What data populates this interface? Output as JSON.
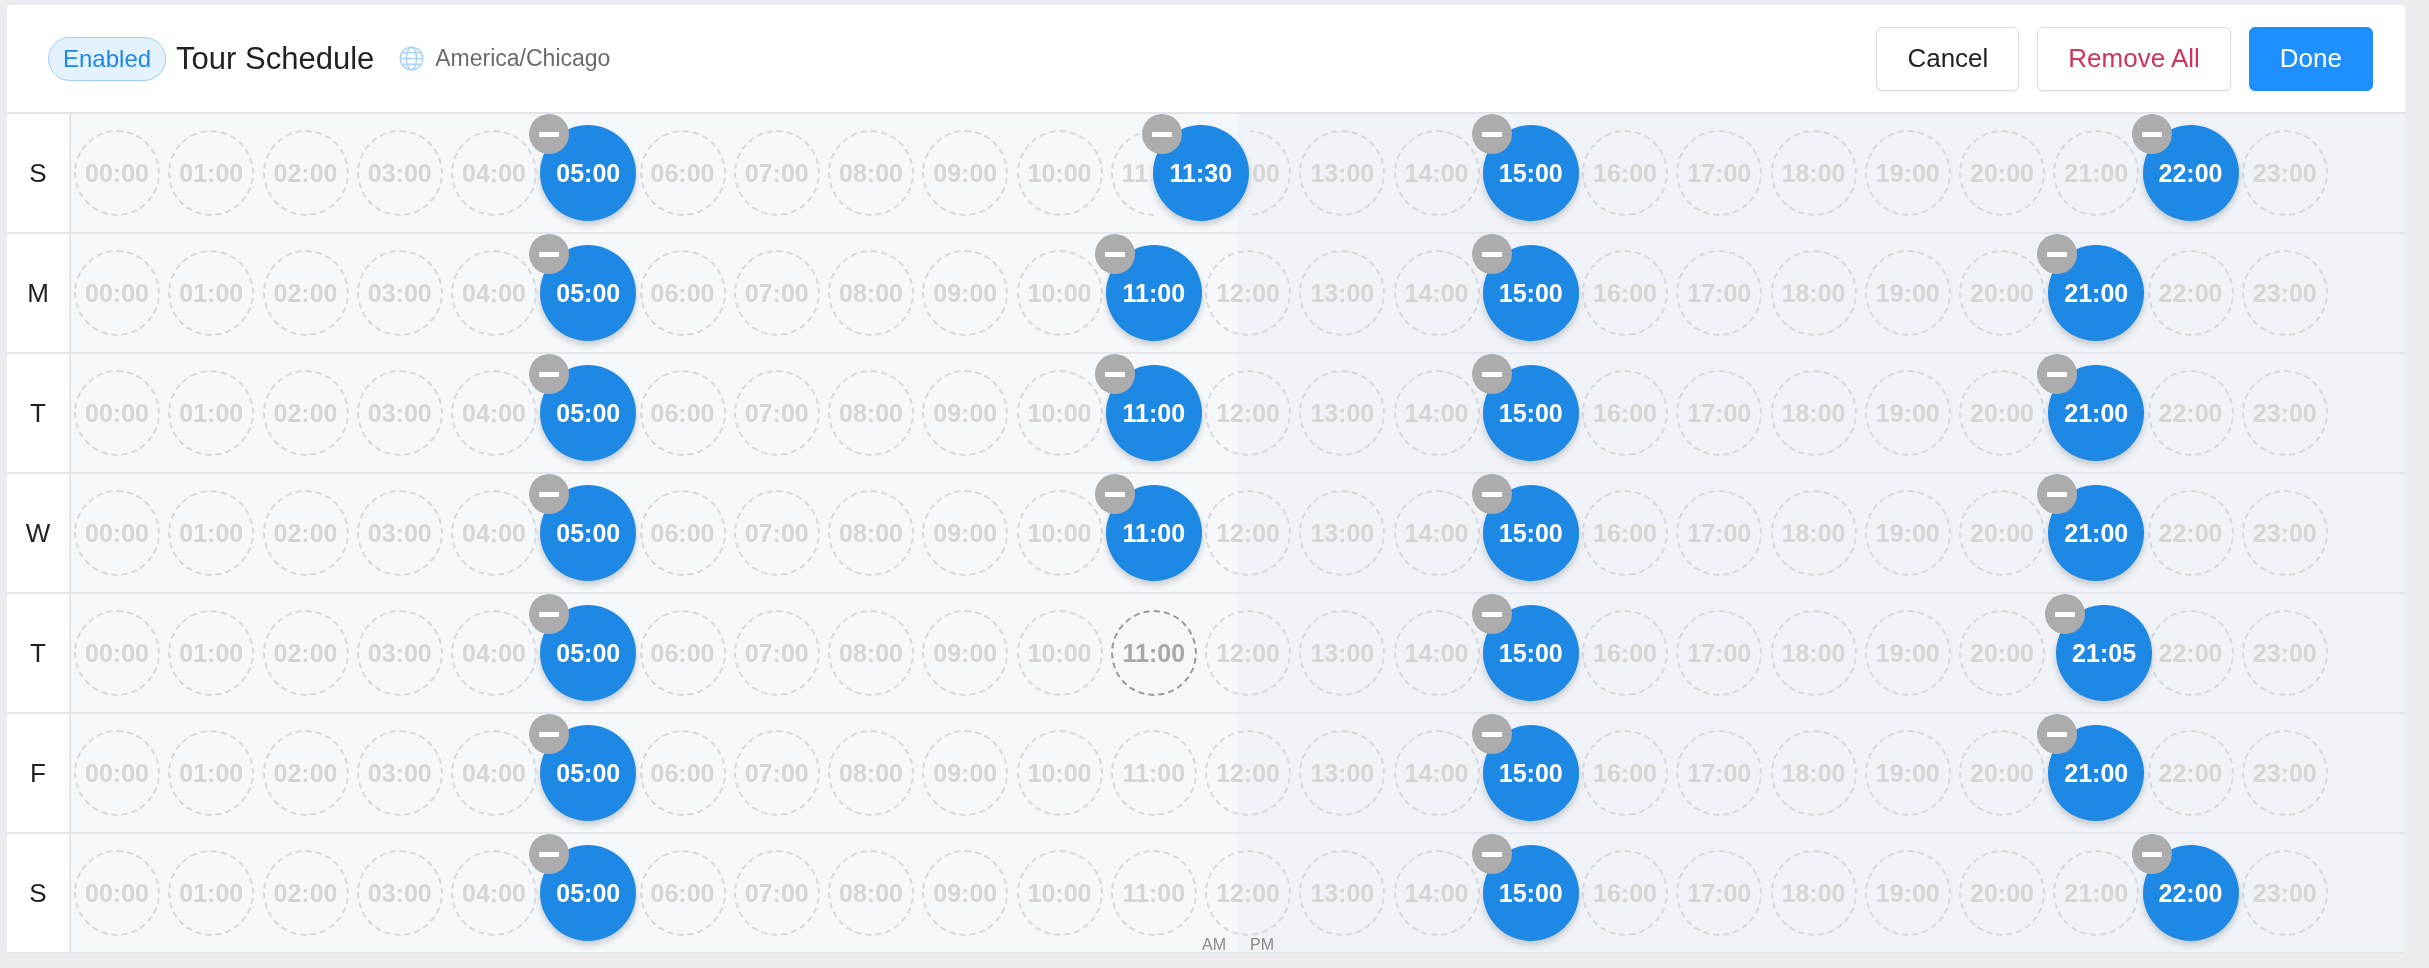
{
  "header": {
    "status": "Enabled",
    "title": "Tour Schedule",
    "timezone": "America/Chicago",
    "buttons": [
      {
        "label": "Cancel",
        "kind": "plain"
      },
      {
        "label": "Remove All",
        "kind": "danger"
      },
      {
        "label": "Done",
        "kind": "primary"
      }
    ]
  },
  "days": [
    {
      "day": "S",
      "slots": [
        {
          "kind": "open",
          "label": "00:00",
          "hovered": false
        },
        {
          "kind": "open",
          "label": "01:00",
          "hovered": false
        },
        {
          "kind": "open",
          "label": "02:00",
          "hovered": false
        },
        {
          "kind": "open",
          "label": "03:00",
          "hovered": false
        },
        {
          "kind": "open",
          "label": "04:00",
          "hovered": false
        },
        {
          "kind": "covered"
        },
        {
          "kind": "open",
          "label": "06:00",
          "hovered": false
        },
        {
          "kind": "open",
          "label": "07:00",
          "hovered": false
        },
        {
          "kind": "open",
          "label": "08:00",
          "hovered": false
        },
        {
          "kind": "open",
          "label": "09:00",
          "hovered": false
        },
        {
          "kind": "open",
          "label": "10:00",
          "hovered": false
        },
        {
          "kind": "head",
          "label": "11",
          "hovered": false
        },
        {
          "kind": "tail",
          "label": "00",
          "hovered": false
        },
        {
          "kind": "open",
          "label": "13:00",
          "hovered": false
        },
        {
          "kind": "open",
          "label": "14:00",
          "hovered": false
        },
        {
          "kind": "covered"
        },
        {
          "kind": "open",
          "label": "16:00",
          "hovered": false
        },
        {
          "kind": "open",
          "label": "17:00",
          "hovered": false
        },
        {
          "kind": "open",
          "label": "18:00",
          "hovered": false
        },
        {
          "kind": "open",
          "label": "19:00",
          "hovered": false
        },
        {
          "kind": "open",
          "label": "20:00",
          "hovered": false
        },
        {
          "kind": "open",
          "label": "21:00",
          "hovered": false
        },
        {
          "kind": "covered"
        },
        {
          "kind": "open",
          "label": "23:00",
          "hovered": false
        }
      ],
      "times": [
        {
          "label": "05:00"
        },
        {
          "label": "11:30"
        },
        {
          "label": "15:00"
        },
        {
          "label": "22:00"
        }
      ]
    },
    {
      "day": "M",
      "slots": [
        {
          "kind": "open",
          "label": "00:00",
          "hovered": false
        },
        {
          "kind": "open",
          "label": "01:00",
          "hovered": false
        },
        {
          "kind": "open",
          "label": "02:00",
          "hovered": false
        },
        {
          "kind": "open",
          "label": "03:00",
          "hovered": false
        },
        {
          "kind": "open",
          "label": "04:00",
          "hovered": false
        },
        {
          "kind": "covered"
        },
        {
          "kind": "open",
          "label": "06:00",
          "hovered": false
        },
        {
          "kind": "open",
          "label": "07:00",
          "hovered": false
        },
        {
          "kind": "open",
          "label": "08:00",
          "hovered": false
        },
        {
          "kind": "open",
          "label": "09:00",
          "hovered": false
        },
        {
          "kind": "open",
          "label": "10:00",
          "hovered": false
        },
        {
          "kind": "covered"
        },
        {
          "kind": "open",
          "label": "12:00",
          "hovered": false
        },
        {
          "kind": "open",
          "label": "13:00",
          "hovered": false
        },
        {
          "kind": "open",
          "label": "14:00",
          "hovered": false
        },
        {
          "kind": "covered"
        },
        {
          "kind": "open",
          "label": "16:00",
          "hovered": false
        },
        {
          "kind": "open",
          "label": "17:00",
          "hovered": false
        },
        {
          "kind": "open",
          "label": "18:00",
          "hovered": false
        },
        {
          "kind": "open",
          "label": "19:00",
          "hovered": false
        },
        {
          "kind": "open",
          "label": "20:00",
          "hovered": false
        },
        {
          "kind": "covered"
        },
        {
          "kind": "open",
          "label": "22:00",
          "hovered": false
        },
        {
          "kind": "open",
          "label": "23:00",
          "hovered": false
        }
      ],
      "times": [
        {
          "label": "05:00"
        },
        {
          "label": "11:00"
        },
        {
          "label": "15:00"
        },
        {
          "label": "21:00"
        }
      ]
    },
    {
      "day": "T",
      "slots": [
        {
          "kind": "open",
          "label": "00:00",
          "hovered": false
        },
        {
          "kind": "open",
          "label": "01:00",
          "hovered": false
        },
        {
          "kind": "open",
          "label": "02:00",
          "hovered": false
        },
        {
          "kind": "open",
          "label": "03:00",
          "hovered": false
        },
        {
          "kind": "open",
          "label": "04:00",
          "hovered": false
        },
        {
          "kind": "covered"
        },
        {
          "kind": "open",
          "label": "06:00",
          "hovered": false
        },
        {
          "kind": "open",
          "label": "07:00",
          "hovered": false
        },
        {
          "kind": "open",
          "label": "08:00",
          "hovered": false
        },
        {
          "kind": "open",
          "label": "09:00",
          "hovered": false
        },
        {
          "kind": "open",
          "label": "10:00",
          "hovered": false
        },
        {
          "kind": "covered"
        },
        {
          "kind": "open",
          "label": "12:00",
          "hovered": false
        },
        {
          "kind": "open",
          "label": "13:00",
          "hovered": false
        },
        {
          "kind": "open",
          "label": "14:00",
          "hovered": false
        },
        {
          "kind": "covered"
        },
        {
          "kind": "open",
          "label": "16:00",
          "hovered": false
        },
        {
          "kind": "open",
          "label": "17:00",
          "hovered": false
        },
        {
          "kind": "open",
          "label": "18:00",
          "hovered": false
        },
        {
          "kind": "open",
          "label": "19:00",
          "hovered": false
        },
        {
          "kind": "open",
          "label": "20:00",
          "hovered": false
        },
        {
          "kind": "covered"
        },
        {
          "kind": "open",
          "label": "22:00",
          "hovered": false
        },
        {
          "kind": "open",
          "label": "23:00",
          "hovered": false
        }
      ],
      "times": [
        {
          "label": "05:00"
        },
        {
          "label": "11:00"
        },
        {
          "label": "15:00"
        },
        {
          "label": "21:00"
        }
      ]
    },
    {
      "day": "W",
      "slots": [
        {
          "kind": "open",
          "label": "00:00",
          "hovered": false
        },
        {
          "kind": "open",
          "label": "01:00",
          "hovered": false
        },
        {
          "kind": "open",
          "label": "02:00",
          "hovered": false
        },
        {
          "kind": "open",
          "label": "03:00",
          "hovered": false
        },
        {
          "kind": "open",
          "label": "04:00",
          "hovered": false
        },
        {
          "kind": "covered"
        },
        {
          "kind": "open",
          "label": "06:00",
          "hovered": false
        },
        {
          "kind": "open",
          "label": "07:00",
          "hovered": false
        },
        {
          "kind": "open",
          "label": "08:00",
          "hovered": false
        },
        {
          "kind": "open",
          "label": "09:00",
          "hovered": false
        },
        {
          "kind": "open",
          "label": "10:00",
          "hovered": false
        },
        {
          "kind": "covered"
        },
        {
          "kind": "open",
          "label": "12:00",
          "hovered": false
        },
        {
          "kind": "open",
          "label": "13:00",
          "hovered": false
        },
        {
          "kind": "open",
          "label": "14:00",
          "hovered": false
        },
        {
          "kind": "covered"
        },
        {
          "kind": "open",
          "label": "16:00",
          "hovered": false
        },
        {
          "kind": "open",
          "label": "17:00",
          "hovered": false
        },
        {
          "kind": "open",
          "label": "18:00",
          "hovered": false
        },
        {
          "kind": "open",
          "label": "19:00",
          "hovered": false
        },
        {
          "kind": "open",
          "label": "20:00",
          "hovered": false
        },
        {
          "kind": "covered"
        },
        {
          "kind": "open",
          "label": "22:00",
          "hovered": false
        },
        {
          "kind": "open",
          "label": "23:00",
          "hovered": false
        }
      ],
      "times": [
        {
          "label": "05:00"
        },
        {
          "label": "11:00"
        },
        {
          "label": "15:00"
        },
        {
          "label": "21:00"
        }
      ]
    },
    {
      "day": "T",
      "slots": [
        {
          "kind": "open",
          "label": "00:00",
          "hovered": false
        },
        {
          "kind": "open",
          "label": "01:00",
          "hovered": false
        },
        {
          "kind": "open",
          "label": "02:00",
          "hovered": false
        },
        {
          "kind": "open",
          "label": "03:00",
          "hovered": false
        },
        {
          "kind": "open",
          "label": "04:00",
          "hovered": false
        },
        {
          "kind": "covered"
        },
        {
          "kind": "open",
          "label": "06:00",
          "hovered": false
        },
        {
          "kind": "open",
          "label": "07:00",
          "hovered": false
        },
        {
          "kind": "open",
          "label": "08:00",
          "hovered": false
        },
        {
          "kind": "open",
          "label": "09:00",
          "hovered": false
        },
        {
          "kind": "open",
          "label": "10:00",
          "hovered": false
        },
        {
          "kind": "open",
          "label": "11:00",
          "hovered": true
        },
        {
          "kind": "open",
          "label": "12:00",
          "hovered": false
        },
        {
          "kind": "open",
          "label": "13:00",
          "hovered": false
        },
        {
          "kind": "open",
          "label": "14:00",
          "hovered": false
        },
        {
          "kind": "covered"
        },
        {
          "kind": "open",
          "label": "16:00",
          "hovered": false
        },
        {
          "kind": "open",
          "label": "17:00",
          "hovered": false
        },
        {
          "kind": "open",
          "label": "18:00",
          "hovered": false
        },
        {
          "kind": "open",
          "label": "19:00",
          "hovered": false
        },
        {
          "kind": "open",
          "label": "20:00",
          "hovered": false
        },
        {
          "kind": "covered"
        },
        {
          "kind": "open",
          "label": "22:00",
          "hovered": false
        },
        {
          "kind": "open",
          "label": "23:00",
          "hovered": false
        }
      ],
      "times": [
        {
          "label": "05:00"
        },
        {
          "label": "15:00"
        },
        {
          "label": "21:05"
        }
      ]
    },
    {
      "day": "F",
      "slots": [
        {
          "kind": "open",
          "label": "00:00",
          "hovered": false
        },
        {
          "kind": "open",
          "label": "01:00",
          "hovered": false
        },
        {
          "kind": "open",
          "label": "02:00",
          "hovered": false
        },
        {
          "kind": "open",
          "label": "03:00",
          "hovered": false
        },
        {
          "kind": "open",
          "label": "04:00",
          "hovered": false
        },
        {
          "kind": "covered"
        },
        {
          "kind": "open",
          "label": "06:00",
          "hovered": false
        },
        {
          "kind": "open",
          "label": "07:00",
          "hovered": false
        },
        {
          "kind": "open",
          "label": "08:00",
          "hovered": false
        },
        {
          "kind": "open",
          "label": "09:00",
          "hovered": false
        },
        {
          "kind": "open",
          "label": "10:00",
          "hovered": false
        },
        {
          "kind": "open",
          "label": "11:00",
          "hovered": false
        },
        {
          "kind": "open",
          "label": "12:00",
          "hovered": false
        },
        {
          "kind": "open",
          "label": "13:00",
          "hovered": false
        },
        {
          "kind": "open",
          "label": "14:00",
          "hovered": false
        },
        {
          "kind": "covered"
        },
        {
          "kind": "open",
          "label": "16:00",
          "hovered": false
        },
        {
          "kind": "open",
          "label": "17:00",
          "hovered": false
        },
        {
          "kind": "open",
          "label": "18:00",
          "hovered": false
        },
        {
          "kind": "open",
          "label": "19:00",
          "hovered": false
        },
        {
          "kind": "open",
          "label": "20:00",
          "hovered": false
        },
        {
          "kind": "covered"
        },
        {
          "kind": "open",
          "label": "22:00",
          "hovered": false
        },
        {
          "kind": "open",
          "label": "23:00",
          "hovered": false
        }
      ],
      "times": [
        {
          "label": "05:00"
        },
        {
          "label": "15:00"
        },
        {
          "label": "21:00"
        }
      ]
    },
    {
      "day": "S",
      "slots": [
        {
          "kind": "open",
          "label": "00:00",
          "hovered": false
        },
        {
          "kind": "open",
          "label": "01:00",
          "hovered": false
        },
        {
          "kind": "open",
          "label": "02:00",
          "hovered": false
        },
        {
          "kind": "open",
          "label": "03:00",
          "hovered": false
        },
        {
          "kind": "open",
          "label": "04:00",
          "hovered": false
        },
        {
          "kind": "covered"
        },
        {
          "kind": "open",
          "label": "06:00",
          "hovered": false
        },
        {
          "kind": "open",
          "label": "07:00",
          "hovered": false
        },
        {
          "kind": "open",
          "label": "08:00",
          "hovered": false
        },
        {
          "kind": "open",
          "label": "09:00",
          "hovered": false
        },
        {
          "kind": "open",
          "label": "10:00",
          "hovered": false
        },
        {
          "kind": "open",
          "label": "11:00",
          "hovered": false
        },
        {
          "kind": "open",
          "label": "12:00",
          "hovered": false
        },
        {
          "kind": "open",
          "label": "13:00",
          "hovered": false
        },
        {
          "kind": "open",
          "label": "14:00",
          "hovered": false
        },
        {
          "kind": "covered"
        },
        {
          "kind": "open",
          "label": "16:00",
          "hovered": false
        },
        {
          "kind": "open",
          "label": "17:00",
          "hovered": false
        },
        {
          "kind": "open",
          "label": "18:00",
          "hovered": false
        },
        {
          "kind": "open",
          "label": "19:00",
          "hovered": false
        },
        {
          "kind": "open",
          "label": "20:00",
          "hovered": false
        },
        {
          "kind": "open",
          "label": "21:00",
          "hovered": false
        },
        {
          "kind": "covered"
        },
        {
          "kind": "open",
          "label": "23:00",
          "hovered": false
        }
      ],
      "times": [
        {
          "label": "05:00"
        },
        {
          "label": "15:00"
        },
        {
          "label": "22:00"
        }
      ]
    }
  ],
  "period_labels": [
    "AM",
    "PM"
  ]
}
